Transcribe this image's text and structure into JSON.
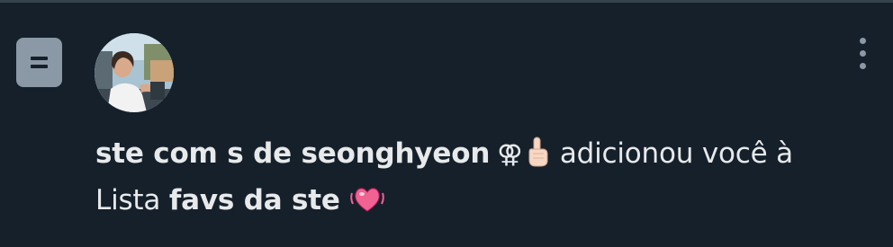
{
  "notification": {
    "user_name": "ste com s de seonghyeon",
    "name_symbol": "⚢",
    "name_emoji": "☝🏻",
    "action_text": "adicionou você à",
    "list_prefix": "Lista",
    "list_name": "favs da ste",
    "list_emoji": "💓"
  },
  "icons": {
    "list": "list-icon",
    "more": "more-options-icon"
  },
  "colors": {
    "background": "#15202b",
    "icon_gray": "#8b98a5",
    "text": "#e7e9ea",
    "heart": "#f06292"
  }
}
